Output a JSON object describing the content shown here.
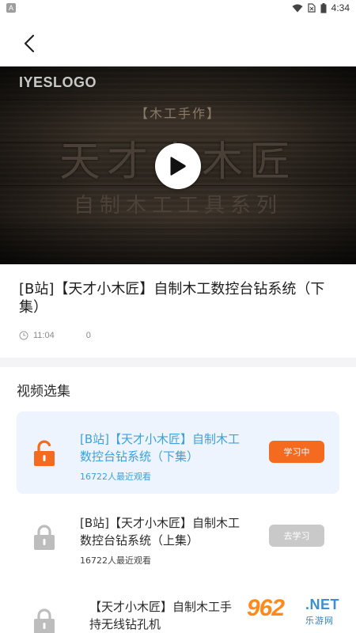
{
  "status_bar": {
    "app_badge": "A",
    "time": "4:34"
  },
  "video": {
    "logo": "IYESLOGO",
    "overlay_tag": "【木工手作】",
    "overlay_title": "天才小木匠",
    "overlay_subtitle": "自制木工工具系列"
  },
  "info": {
    "title": "[B站]【天才小木匠】自制木工数控台钻系统（下集）",
    "duration": "11:04",
    "views": "0"
  },
  "episodes": {
    "section_title": "视频选集",
    "items": [
      {
        "title": "[B站]【天才小木匠】自制木工数控台钻系统（下集）",
        "viewers": "16722人最近观看",
        "button": "学习中",
        "locked": false
      },
      {
        "title": "[B站]【天才小木匠】自制木工数控台钻系统（上集）",
        "viewers": "16722人最近观看",
        "button": "去学习",
        "locked": true
      },
      {
        "title": "【天才小木匠】自制木工手持无线钻孔机",
        "viewers": "",
        "button": "",
        "locked": true
      }
    ]
  },
  "watermark": {
    "number": "962",
    "net": ".NET",
    "cn": "乐游网"
  },
  "colors": {
    "accent_orange": "#f46a1f",
    "active_text": "#3aa2e0",
    "active_bg": "#eef4fd",
    "disabled_button": "#c9c9c9"
  },
  "icons": {
    "back": "back-arrow-icon",
    "play": "play-icon",
    "clock": "clock-icon",
    "unlocked": "unlock-icon",
    "locked": "lock-icon"
  }
}
